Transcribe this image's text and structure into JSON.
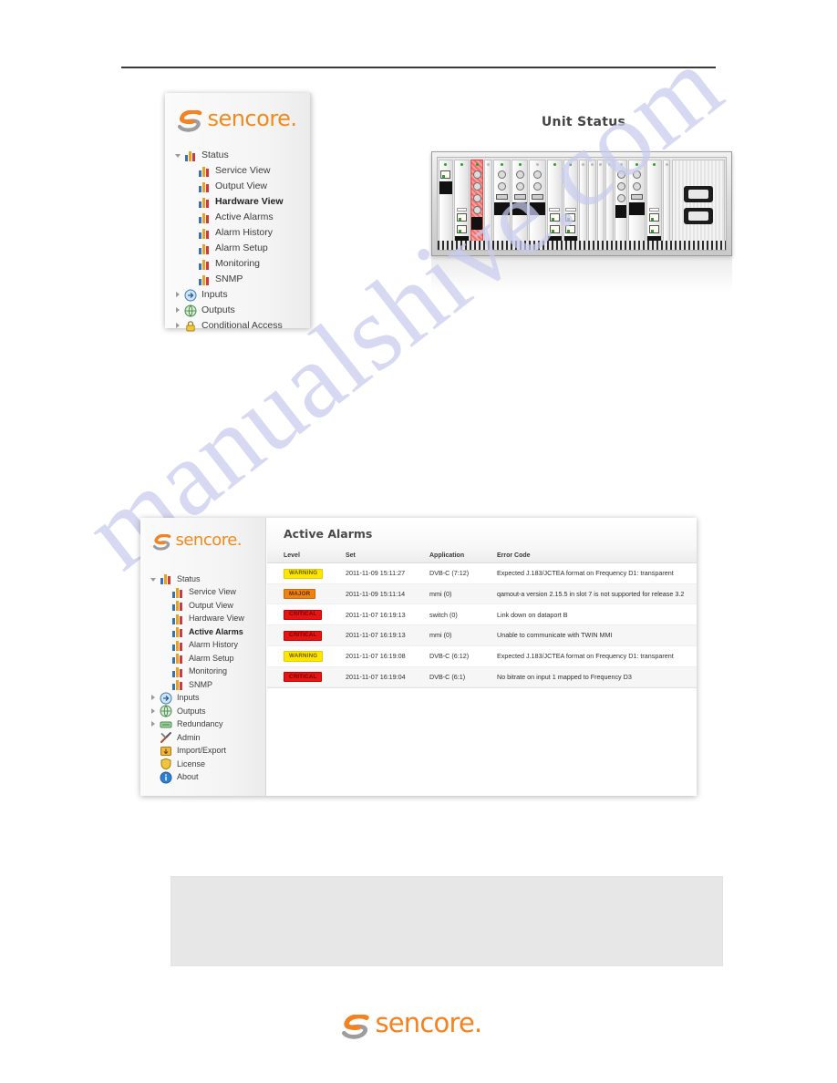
{
  "watermark": {
    "text": "manualshive.com"
  },
  "panel_hardware_view": {
    "logo_text": "sencore.",
    "nav": [
      {
        "label": "Status",
        "icon": "bar-chart-icon",
        "toggle": "down",
        "level": 0,
        "bold": false
      },
      {
        "label": "Service View",
        "icon": "bar-chart-icon",
        "toggle": "none",
        "level": 1,
        "bold": false
      },
      {
        "label": "Output View",
        "icon": "bar-chart-icon",
        "toggle": "none",
        "level": 1,
        "bold": false
      },
      {
        "label": "Hardware View",
        "icon": "bar-chart-icon",
        "toggle": "none",
        "level": 1,
        "bold": true
      },
      {
        "label": "Active Alarms",
        "icon": "bar-chart-icon",
        "toggle": "none",
        "level": 1,
        "bold": false
      },
      {
        "label": "Alarm History",
        "icon": "bar-chart-icon",
        "toggle": "none",
        "level": 1,
        "bold": false
      },
      {
        "label": "Alarm Setup",
        "icon": "bar-chart-icon",
        "toggle": "none",
        "level": 1,
        "bold": false
      },
      {
        "label": "Monitoring",
        "icon": "bar-chart-icon",
        "toggle": "none",
        "level": 1,
        "bold": false
      },
      {
        "label": "SNMP",
        "icon": "bar-chart-icon",
        "toggle": "none",
        "level": 1,
        "bold": false
      },
      {
        "label": "Inputs",
        "icon": "input-arrow-icon",
        "toggle": "right",
        "level": 0,
        "bold": false
      },
      {
        "label": "Outputs",
        "icon": "output-globe-icon",
        "toggle": "right",
        "level": 0,
        "bold": false
      },
      {
        "label": "Conditional Access",
        "icon": "lock-icon",
        "toggle": "right",
        "level": 0,
        "bold": false
      }
    ]
  },
  "unit_status": {
    "title": "Unit Status",
    "slots": [
      {
        "type": "card",
        "alarm": false,
        "led": "on",
        "ports": [
          "rj45"
        ]
      },
      {
        "type": "card",
        "alarm": false,
        "led": "on",
        "ports": [
          "tab",
          "rj45",
          "rj45"
        ]
      },
      {
        "type": "card",
        "alarm": true,
        "led": "on",
        "ports": [
          "bnc",
          "bnc",
          "bnc",
          "bnc"
        ]
      },
      {
        "type": "blank",
        "alarm": false,
        "led": "off",
        "ports": []
      },
      {
        "type": "card",
        "alarm": false,
        "led": "on",
        "ports": [
          "bnc",
          "bnc",
          "dsub"
        ]
      },
      {
        "type": "card",
        "alarm": false,
        "led": "on",
        "ports": [
          "bnc",
          "bnc",
          "dsub"
        ]
      },
      {
        "type": "card",
        "alarm": false,
        "led": "off",
        "ports": [
          "bnc",
          "bnc",
          "dsub"
        ]
      },
      {
        "type": "card",
        "alarm": false,
        "led": "on",
        "ports": [
          "tab",
          "rj45",
          "rj45"
        ]
      },
      {
        "type": "card",
        "alarm": false,
        "led": "on",
        "ports": [
          "tab",
          "rj45",
          "rj45"
        ]
      },
      {
        "type": "blank",
        "alarm": false,
        "led": "off",
        "ports": []
      },
      {
        "type": "blank",
        "alarm": false,
        "led": "off",
        "ports": []
      },
      {
        "type": "blank",
        "alarm": false,
        "led": "off",
        "ports": []
      },
      {
        "type": "blank",
        "alarm": false,
        "led": "off",
        "ports": []
      },
      {
        "type": "card",
        "alarm": false,
        "led": "off",
        "ports": [
          "bnc",
          "bnc",
          "bnc"
        ]
      },
      {
        "type": "card",
        "alarm": false,
        "led": "on",
        "ports": [
          "bnc",
          "bnc",
          "dsub"
        ]
      },
      {
        "type": "card",
        "alarm": false,
        "led": "on",
        "ports": [
          "tab",
          "rj45",
          "rj45"
        ]
      },
      {
        "type": "blank",
        "alarm": false,
        "led": "off",
        "ports": []
      }
    ]
  },
  "panel_active_alarms": {
    "logo_text": "sencore.",
    "nav": [
      {
        "label": "Status",
        "icon": "bar-chart-icon",
        "toggle": "down",
        "level": 0,
        "bold": false
      },
      {
        "label": "Service View",
        "icon": "bar-chart-icon",
        "toggle": "none",
        "level": 1,
        "bold": false
      },
      {
        "label": "Output View",
        "icon": "bar-chart-icon",
        "toggle": "none",
        "level": 1,
        "bold": false
      },
      {
        "label": "Hardware View",
        "icon": "bar-chart-icon",
        "toggle": "none",
        "level": 1,
        "bold": false
      },
      {
        "label": "Active Alarms",
        "icon": "bar-chart-icon",
        "toggle": "none",
        "level": 1,
        "bold": true
      },
      {
        "label": "Alarm History",
        "icon": "bar-chart-icon",
        "toggle": "none",
        "level": 1,
        "bold": false
      },
      {
        "label": "Alarm Setup",
        "icon": "bar-chart-icon",
        "toggle": "none",
        "level": 1,
        "bold": false
      },
      {
        "label": "Monitoring",
        "icon": "bar-chart-icon",
        "toggle": "none",
        "level": 1,
        "bold": false
      },
      {
        "label": "SNMP",
        "icon": "bar-chart-icon",
        "toggle": "none",
        "level": 1,
        "bold": false
      },
      {
        "label": "Inputs",
        "icon": "input-arrow-icon",
        "toggle": "right",
        "level": 0,
        "bold": false
      },
      {
        "label": "Outputs",
        "icon": "output-globe-icon",
        "toggle": "right",
        "level": 0,
        "bold": false
      },
      {
        "label": "Redundancy",
        "icon": "redundancy-icon",
        "toggle": "right",
        "level": 0,
        "bold": false
      },
      {
        "label": "Admin",
        "icon": "tools-icon",
        "toggle": "none",
        "level": 0,
        "bold": false
      },
      {
        "label": "Import/Export",
        "icon": "import-export-icon",
        "toggle": "none",
        "level": 0,
        "bold": false
      },
      {
        "label": "License",
        "icon": "shield-icon",
        "toggle": "none",
        "level": 0,
        "bold": false
      },
      {
        "label": "About",
        "icon": "info-icon",
        "toggle": "none",
        "level": 0,
        "bold": false
      }
    ],
    "title": "Active Alarms",
    "table": {
      "columns": [
        "Level",
        "Set",
        "Application",
        "Error Code"
      ],
      "rows": [
        {
          "level": "WARNING",
          "level_class": "warning",
          "set": "2011-11-09 15:11:27",
          "application": "DVB-C (7:12)",
          "error": "Expected J.183/JCTEA format on Frequency D1: transparent"
        },
        {
          "level": "MAJOR",
          "level_class": "major",
          "set": "2011-11-09 15:11:14",
          "application": "mmi (0)",
          "error": "qamout-a version 2.15.5 in slot 7 is not supported for release 3.2"
        },
        {
          "level": "CRITICAL",
          "level_class": "critical",
          "set": "2011-11-07 16:19:13",
          "application": "switch (0)",
          "error": "Link down on dataport B"
        },
        {
          "level": "CRITICAL",
          "level_class": "critical",
          "set": "2011-11-07 16:19:13",
          "application": "mmi (0)",
          "error": "Unable to communicate with TWIN MMI"
        },
        {
          "level": "WARNING",
          "level_class": "warning",
          "set": "2011-11-07 16:19:08",
          "application": "DVB-C (6:12)",
          "error": "Expected J.183/JCTEA format on Frequency D1: transparent"
        },
        {
          "level": "CRITICAL",
          "level_class": "critical",
          "set": "2011-11-07 16:19:04",
          "application": "DVB-C (6:1)",
          "error": "No bitrate on input 1 mapped to Frequency D3"
        }
      ]
    }
  },
  "footer": {
    "logo_text": "sencore."
  },
  "colors": {
    "brand_orange": "#f5821f",
    "warning": "#ffe600",
    "major": "#ef8310",
    "critical": "#e81313",
    "watermark": "#c9cbee"
  }
}
